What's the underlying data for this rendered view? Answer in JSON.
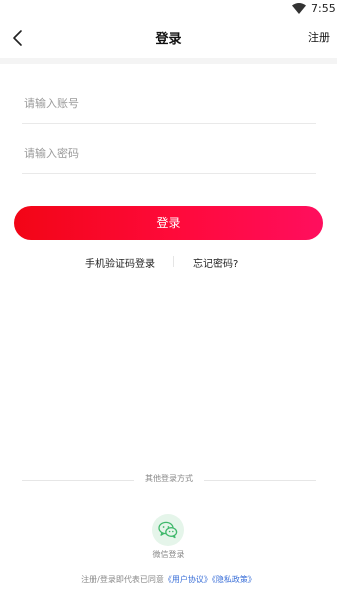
{
  "status_bar": {
    "time": "7:55",
    "wifi_icon": "wifi-icon"
  },
  "nav": {
    "back_icon": "chevron-left-icon",
    "title": "登录",
    "register_label": "注册"
  },
  "form": {
    "account_placeholder": "请输入账号",
    "password_placeholder": "请输入密码",
    "login_button": "登录"
  },
  "links": {
    "sms_login": "手机验证码登录",
    "forgot_password": "忘记密码?"
  },
  "other_login": {
    "title": "其他登录方式",
    "wechat_label": "微信登录",
    "wechat_icon": "wechat-icon"
  },
  "agreement": {
    "prefix": "注册/登录即代表已同意",
    "user_agreement": "《用户协议》",
    "privacy_policy": "《隐私政策》"
  },
  "colors": {
    "button_start": "#f20516",
    "button_end": "#ff0e5e",
    "link_blue": "#3a6fd8",
    "wechat_green": "#3fb86b"
  }
}
